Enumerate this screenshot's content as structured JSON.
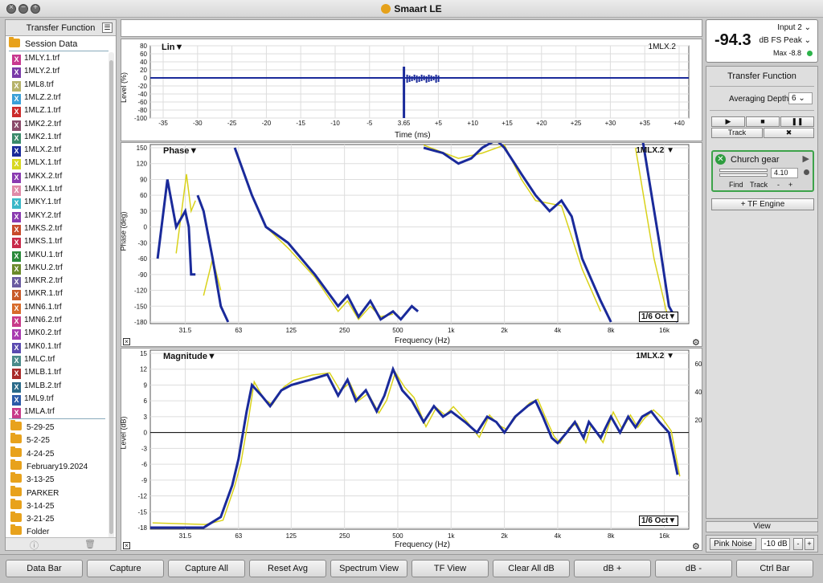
{
  "window": {
    "title": "Smaart LE"
  },
  "sidebar": {
    "title": "Transfer Function",
    "session": "Session Data",
    "files": [
      {
        "name": "1MLY.1.trf",
        "color": "#c8388f"
      },
      {
        "name": "1MLY.2.trf",
        "color": "#7a3aa8"
      },
      {
        "name": "1ML8.trf",
        "color": "#b6b26a"
      },
      {
        "name": "1MLZ.2.trf",
        "color": "#3aa0d8"
      },
      {
        "name": "1MLZ.1.trf",
        "color": "#cc2a2a"
      },
      {
        "name": "1MK2.2.trf",
        "color": "#8a4a6a"
      },
      {
        "name": "1MK2.1.trf",
        "color": "#3a8a6a"
      },
      {
        "name": "1MLX.2.trf",
        "color": "#1a2a9a"
      },
      {
        "name": "1MLX.1.trf",
        "color": "#d8d820"
      },
      {
        "name": "1MKX.2.trf",
        "color": "#8a3ab0"
      },
      {
        "name": "1MKX.1.trf",
        "color": "#e08aa8"
      },
      {
        "name": "1MKY.1.trf",
        "color": "#3ab8c8"
      },
      {
        "name": "1MKY.2.trf",
        "color": "#8a3ab0"
      },
      {
        "name": "1MKS.2.trf",
        "color": "#c84a2a"
      },
      {
        "name": "1MKS.1.trf",
        "color": "#c82a4a"
      },
      {
        "name": "1MKU.1.trf",
        "color": "#2a8a3a"
      },
      {
        "name": "1MKU.2.trf",
        "color": "#6a8a2a"
      },
      {
        "name": "1MKR.2.trf",
        "color": "#6a5aa0"
      },
      {
        "name": "1MKR.1.trf",
        "color": "#c85a2a"
      },
      {
        "name": "1MN6.1.trf",
        "color": "#d86a2a"
      },
      {
        "name": "1MN6.2.trf",
        "color": "#c83a8a"
      },
      {
        "name": "1MK0.2.trf",
        "color": "#a83ab0"
      },
      {
        "name": "1MK0.1.trf",
        "color": "#5a4ab0"
      },
      {
        "name": "1MLC.trf",
        "color": "#4a8a8a"
      },
      {
        "name": "1MLB.1.trf",
        "color": "#a82a2a"
      },
      {
        "name": "1MLB.2.trf",
        "color": "#2a6a8a"
      },
      {
        "name": "1ML9.trf",
        "color": "#2a5aa8"
      },
      {
        "name": "1MLA.trf",
        "color": "#c83a8a"
      }
    ],
    "folders": [
      "5-29-25",
      "5-2-25",
      "4-24-25",
      "February19.2024",
      "3-13-25",
      "PARKER",
      "3-14-25",
      "3-21-25",
      "Folder"
    ]
  },
  "impulse": {
    "title": "Lin▼",
    "label": "1MLX.2",
    "ylabel": "Level (%)",
    "xlabel": "Time (ms)",
    "yticks": [
      "80",
      "60",
      "40",
      "20",
      "0",
      "-20",
      "-40",
      "-60",
      "-80",
      "-100"
    ],
    "xticks": [
      "-35",
      "-30",
      "-25",
      "-20",
      "-15",
      "-10",
      "-5",
      "3.65",
      "+5",
      "+10",
      "+15",
      "+20",
      "+25",
      "+30",
      "+35",
      "+40"
    ]
  },
  "phase": {
    "title": "Phase▼",
    "label": "1MLX.2 ▼",
    "ylabel": "Phase (deg)",
    "xlabel": "Frequency (Hz)",
    "yticks": [
      "150",
      "120",
      "90",
      "60",
      "30",
      "0",
      "-30",
      "-60",
      "-90",
      "-120",
      "-150",
      "-180"
    ],
    "smoothing": "1/6 Oct▼"
  },
  "magnitude": {
    "title": "Magnitude▼",
    "label": "1MLX.2 ▼",
    "ylabel": "Level (dB)",
    "xlabel": "Frequency (Hz)",
    "yticks": [
      "15",
      "12",
      "9",
      "6",
      "3",
      "0",
      "-3",
      "-6",
      "-9",
      "-12",
      "-15",
      "-18"
    ],
    "ryticks": [
      "60",
      "40",
      "20"
    ],
    "smoothing": "1/6 Oct▼"
  },
  "freq_ticks": [
    "31.5",
    "63",
    "125",
    "250",
    "500",
    "1k",
    "2k",
    "4k",
    "8k",
    "16k"
  ],
  "meter": {
    "value": "-94.3",
    "input": "Input 2",
    "mode": "dB FS Peak",
    "max": "Max -8.8"
  },
  "tf_panel": {
    "title": "Transfer Function",
    "avg_label": "Averaging Depth:",
    "avg_value": "6",
    "track": "Track",
    "engine_name": "Church gear",
    "delay": "4.10",
    "find": "Find",
    "track2": "Track",
    "minus": "-",
    "plus": "+",
    "add_engine": "+ TF Engine"
  },
  "view_label": "View",
  "noise": {
    "label": "Pink Noise",
    "level": "-10 dB",
    "minus": "-",
    "plus": "+"
  },
  "bottom_buttons": [
    "Data Bar",
    "Capture",
    "Capture All",
    "Reset Avg",
    "Spectrum View",
    "TF View",
    "Clear All dB",
    "dB +",
    "dB -",
    "Ctrl Bar"
  ]
}
